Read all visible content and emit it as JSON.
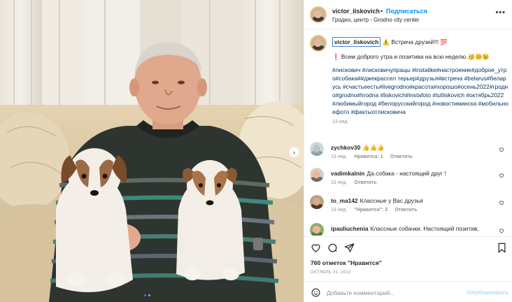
{
  "header": {
    "username": "victor_liskovich",
    "separator": "•",
    "follow_label": "Подписаться",
    "location": "Гродно, центр - Grodno city center",
    "more_icon": "more-horizontal-icon"
  },
  "caption": {
    "username": "victor_liskovich",
    "text": "⚠️ Встреча друзей!!! 💯",
    "paragraph": "❗ Всем доброго утра и позитива на всю неделю.🥳😊😉",
    "hashtags": "#лискович #лисковичупрацы #instalike#настроение#доброе_утро#собака##джекрассел терьер#друзья#встреча #belarus#беларусь #счастьеесть#livegrodno#красота#хорошо#осень2022#гродно#grodno#hrodna #liskovich#instafoto #tutliskovich #октябрь2022 #любимыйгород #белорусскийгород #новостиминска #мобильноефото #фактыотлисковича",
    "time": "13 нед."
  },
  "comments": [
    {
      "username": "zychkov30",
      "text": "👍👍👍",
      "time": "13 нед.",
      "likes": "Нравится: 1",
      "reply": "Ответить"
    },
    {
      "username": "vadimkalnin",
      "text": "Да.собака - настоящий друг !",
      "time": "13 нед.",
      "likes": "",
      "reply": "Ответить"
    },
    {
      "username": "to_ma142",
      "text": "Классные у Вас друзья",
      "time": "13 нед.",
      "likes": "\"Нравится\": 2",
      "reply": "Ответить"
    },
    {
      "username": "ipauliuchenia",
      "text": "Классные собачки. Настоящий позитив,",
      "time": "",
      "likes": "",
      "reply": ""
    }
  ],
  "actions": {
    "likes_count": "760 отметок \"Нравится\"",
    "date": "ОКТЯБРЬ 31, 2022"
  },
  "add_comment": {
    "placeholder": "Добавьте комментарий...",
    "post_label": "Опубликовать"
  },
  "colors": {
    "accent": "#0095f6",
    "hashtag": "#00376b",
    "muted": "#8e8e8e",
    "post_disabled": "#b3dbff"
  }
}
